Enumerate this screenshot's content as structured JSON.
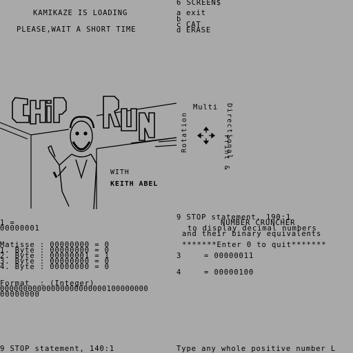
{
  "loader": {
    "line1": "KAMIKAZE IS LOADING",
    "line2": "PLEASE,WAIT A SHORT TIME"
  },
  "menu": {
    "title": "6 SCREEN$",
    "items": [
      {
        "key": "a",
        "label": "exit"
      },
      {
        "key": "b",
        "label": ""
      },
      {
        "key": "c",
        "label": "CAT"
      },
      {
        "key": "d",
        "label": "ERASE"
      }
    ]
  },
  "title_screen": {
    "logo_word1": "CHIP",
    "logo_word2": "RUN",
    "with": "WITH",
    "author": "KEITH ABEL",
    "side_multi": "Multi",
    "side_directional": "Directional",
    "side_rotation": "Rotation",
    "side_print": "Print &"
  },
  "matisse": {
    "eq_line": "1 =",
    "binary": "00000001",
    "rows": [
      "Matisse : 00000000 = 0",
      "1. Byte : 00000000 = 0",
      "2. Byte : 00000001 = 1",
      "3. Byte : 00000000 = 0",
      "4. Byte : 00000000 = 0"
    ],
    "format": "Format  : (Integer)",
    "format_bits_1": "00000000000000000000000100000000",
    "format_bits_2": "00000000",
    "status": "9 STOP statement, 140:1"
  },
  "cruncher": {
    "status": "9 STOP statement, 190:1",
    "title": "NUMBER CRUNCHER",
    "subtitle1": "to display decimal numbers",
    "subtitle2": "and their binary equivalents",
    "quit": "*******Enter 0 to quit*******",
    "row1_num": "3",
    "row1_eq": "= 00000011",
    "row2_num": "4",
    "row2_eq": "= 00000100",
    "prompt": "Type any whole positive number L"
  }
}
